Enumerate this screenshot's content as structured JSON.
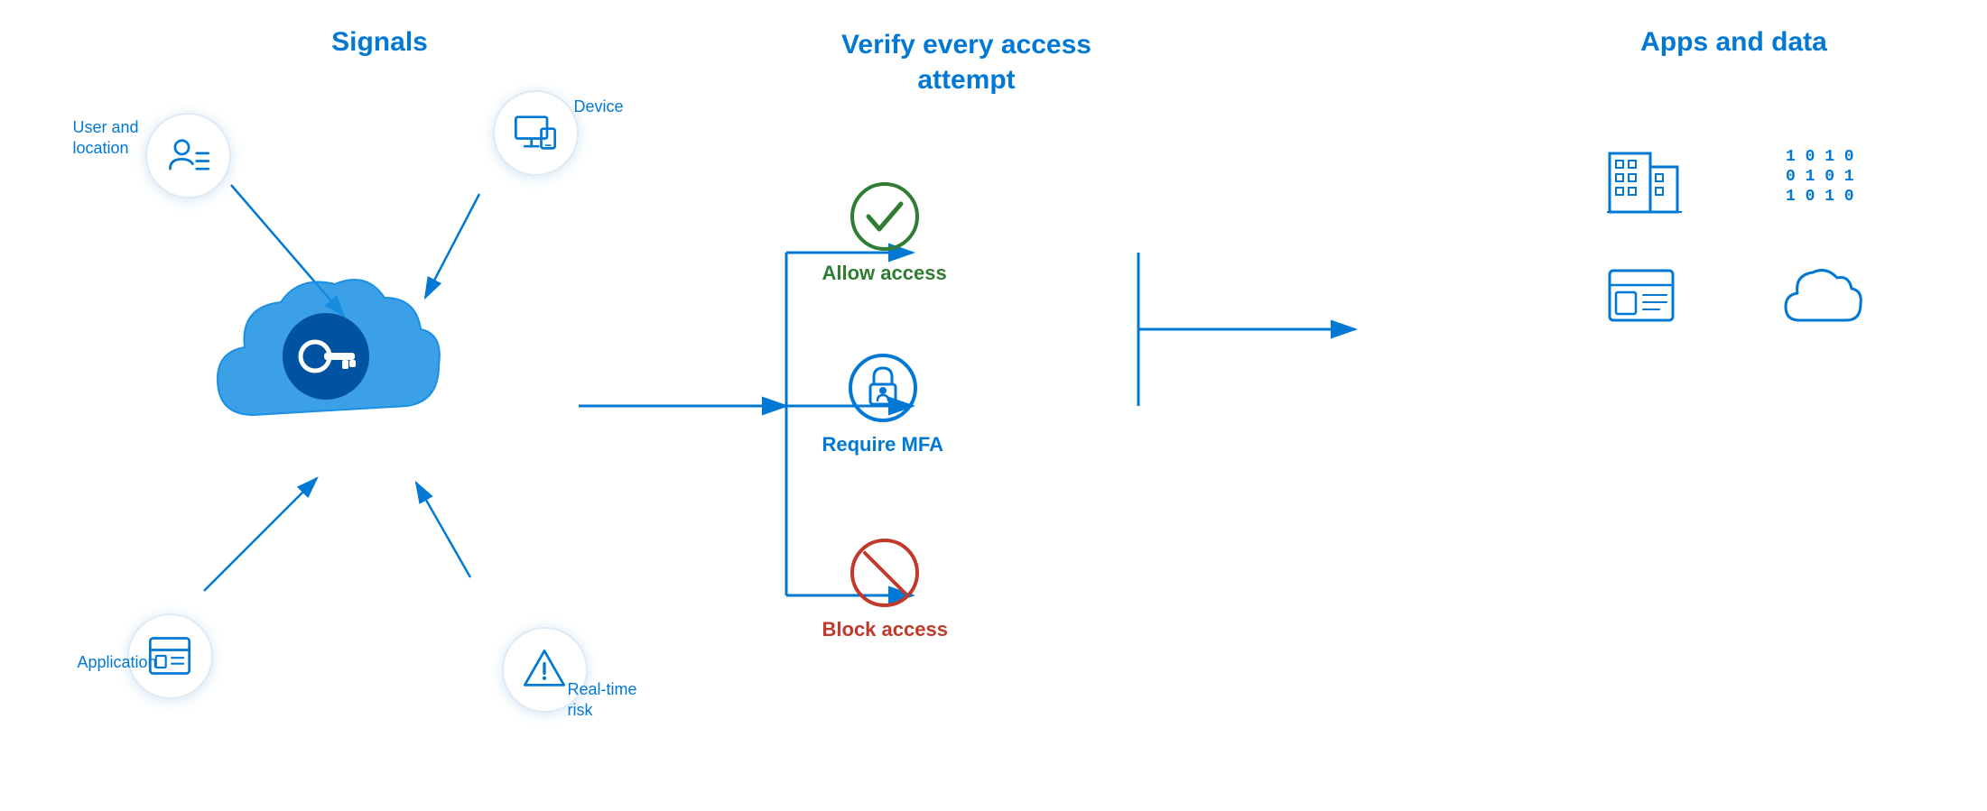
{
  "sections": {
    "signals": {
      "title": "Signals",
      "items": [
        {
          "id": "user",
          "label": "User and\nlocation"
        },
        {
          "id": "device",
          "label": "Device"
        },
        {
          "id": "app",
          "label": "Application"
        },
        {
          "id": "risk",
          "label": "Real-time\nrisk"
        }
      ]
    },
    "verify": {
      "title": "Verify every access\nattempt",
      "outcomes": [
        {
          "id": "allow",
          "label": "Allow access",
          "color": "#2e7d32"
        },
        {
          "id": "mfa",
          "label": "Require MFA",
          "color": "#0078d4"
        },
        {
          "id": "block",
          "label": "Block access",
          "color": "#c0392b"
        }
      ]
    },
    "apps": {
      "title": "Apps and data",
      "items": [
        {
          "id": "building",
          "label": "Building"
        },
        {
          "id": "data",
          "label": "Data"
        },
        {
          "id": "app",
          "label": "App"
        },
        {
          "id": "cloud",
          "label": "Cloud"
        }
      ]
    }
  },
  "colors": {
    "blue": "#0078d4",
    "green": "#2e7d32",
    "red": "#c0392b",
    "lightBlue": "#e8f0fe",
    "white": "#ffffff"
  }
}
